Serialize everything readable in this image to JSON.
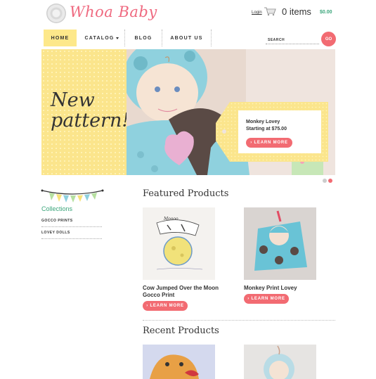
{
  "header": {
    "logo_text": "Whoa Baby",
    "login_label": "Login",
    "cart_items": "0 items",
    "cart_total": "$0.00"
  },
  "nav": {
    "items": [
      {
        "label": "HOME",
        "active": true
      },
      {
        "label": "CATALOG",
        "active": false
      },
      {
        "label": "BLOG",
        "active": false
      },
      {
        "label": "ABOUT US",
        "active": false
      }
    ],
    "search_label": "SEARCH",
    "go_label": "GO"
  },
  "hero": {
    "title_line1": "New",
    "title_line2": "pattern!",
    "product_name": "Monkey Lovey",
    "product_price": "Starting at $75.00",
    "button_label": "› LEARN MORE"
  },
  "sidebar": {
    "collections_title": "Collections",
    "links": [
      "GOCCO PRINTS",
      "LOVEY DOLLS"
    ]
  },
  "featured": {
    "title": "Featured Products",
    "products": [
      {
        "name": "Cow Jumped Over the Moon Gocco Print",
        "button": "› LEARN MORE",
        "image_caption": "Moooo"
      },
      {
        "name": "Monkey Print Lovey",
        "button": "› LEARN MORE"
      }
    ]
  },
  "recent": {
    "title": "Recent Products"
  },
  "colors": {
    "brand_pink": "#ef6a80",
    "button_coral": "#f26b72",
    "accent_green": "#3aa57a",
    "hero_yellow": "#fbe58c"
  }
}
